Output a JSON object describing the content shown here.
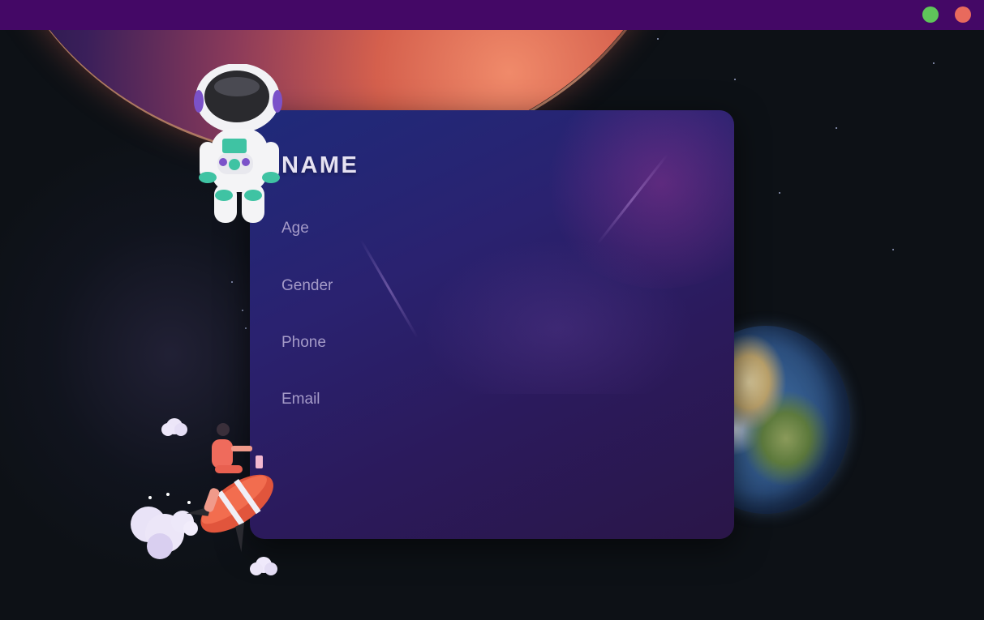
{
  "window": {
    "controls": [
      {
        "name": "maximize",
        "color": "#5fc55a"
      },
      {
        "name": "close",
        "color": "#e86a5d"
      }
    ],
    "titlebar_color": "#440866"
  },
  "profile": {
    "name": "NAME",
    "age_label": "Age",
    "gender_label": "Gender",
    "phone_label": "Phone",
    "email_label": "Email"
  },
  "illustrations": {
    "astronaut": "astronaut-figure",
    "rocket": "rocket-rider-figure",
    "planet_top": "red-planet",
    "planet_right": "earth"
  },
  "colors": {
    "background": "#0d1116",
    "card_start": "#1f2a7a",
    "card_end": "#2a1648",
    "label": "#a59bc8",
    "title": "#e6e2f2"
  }
}
